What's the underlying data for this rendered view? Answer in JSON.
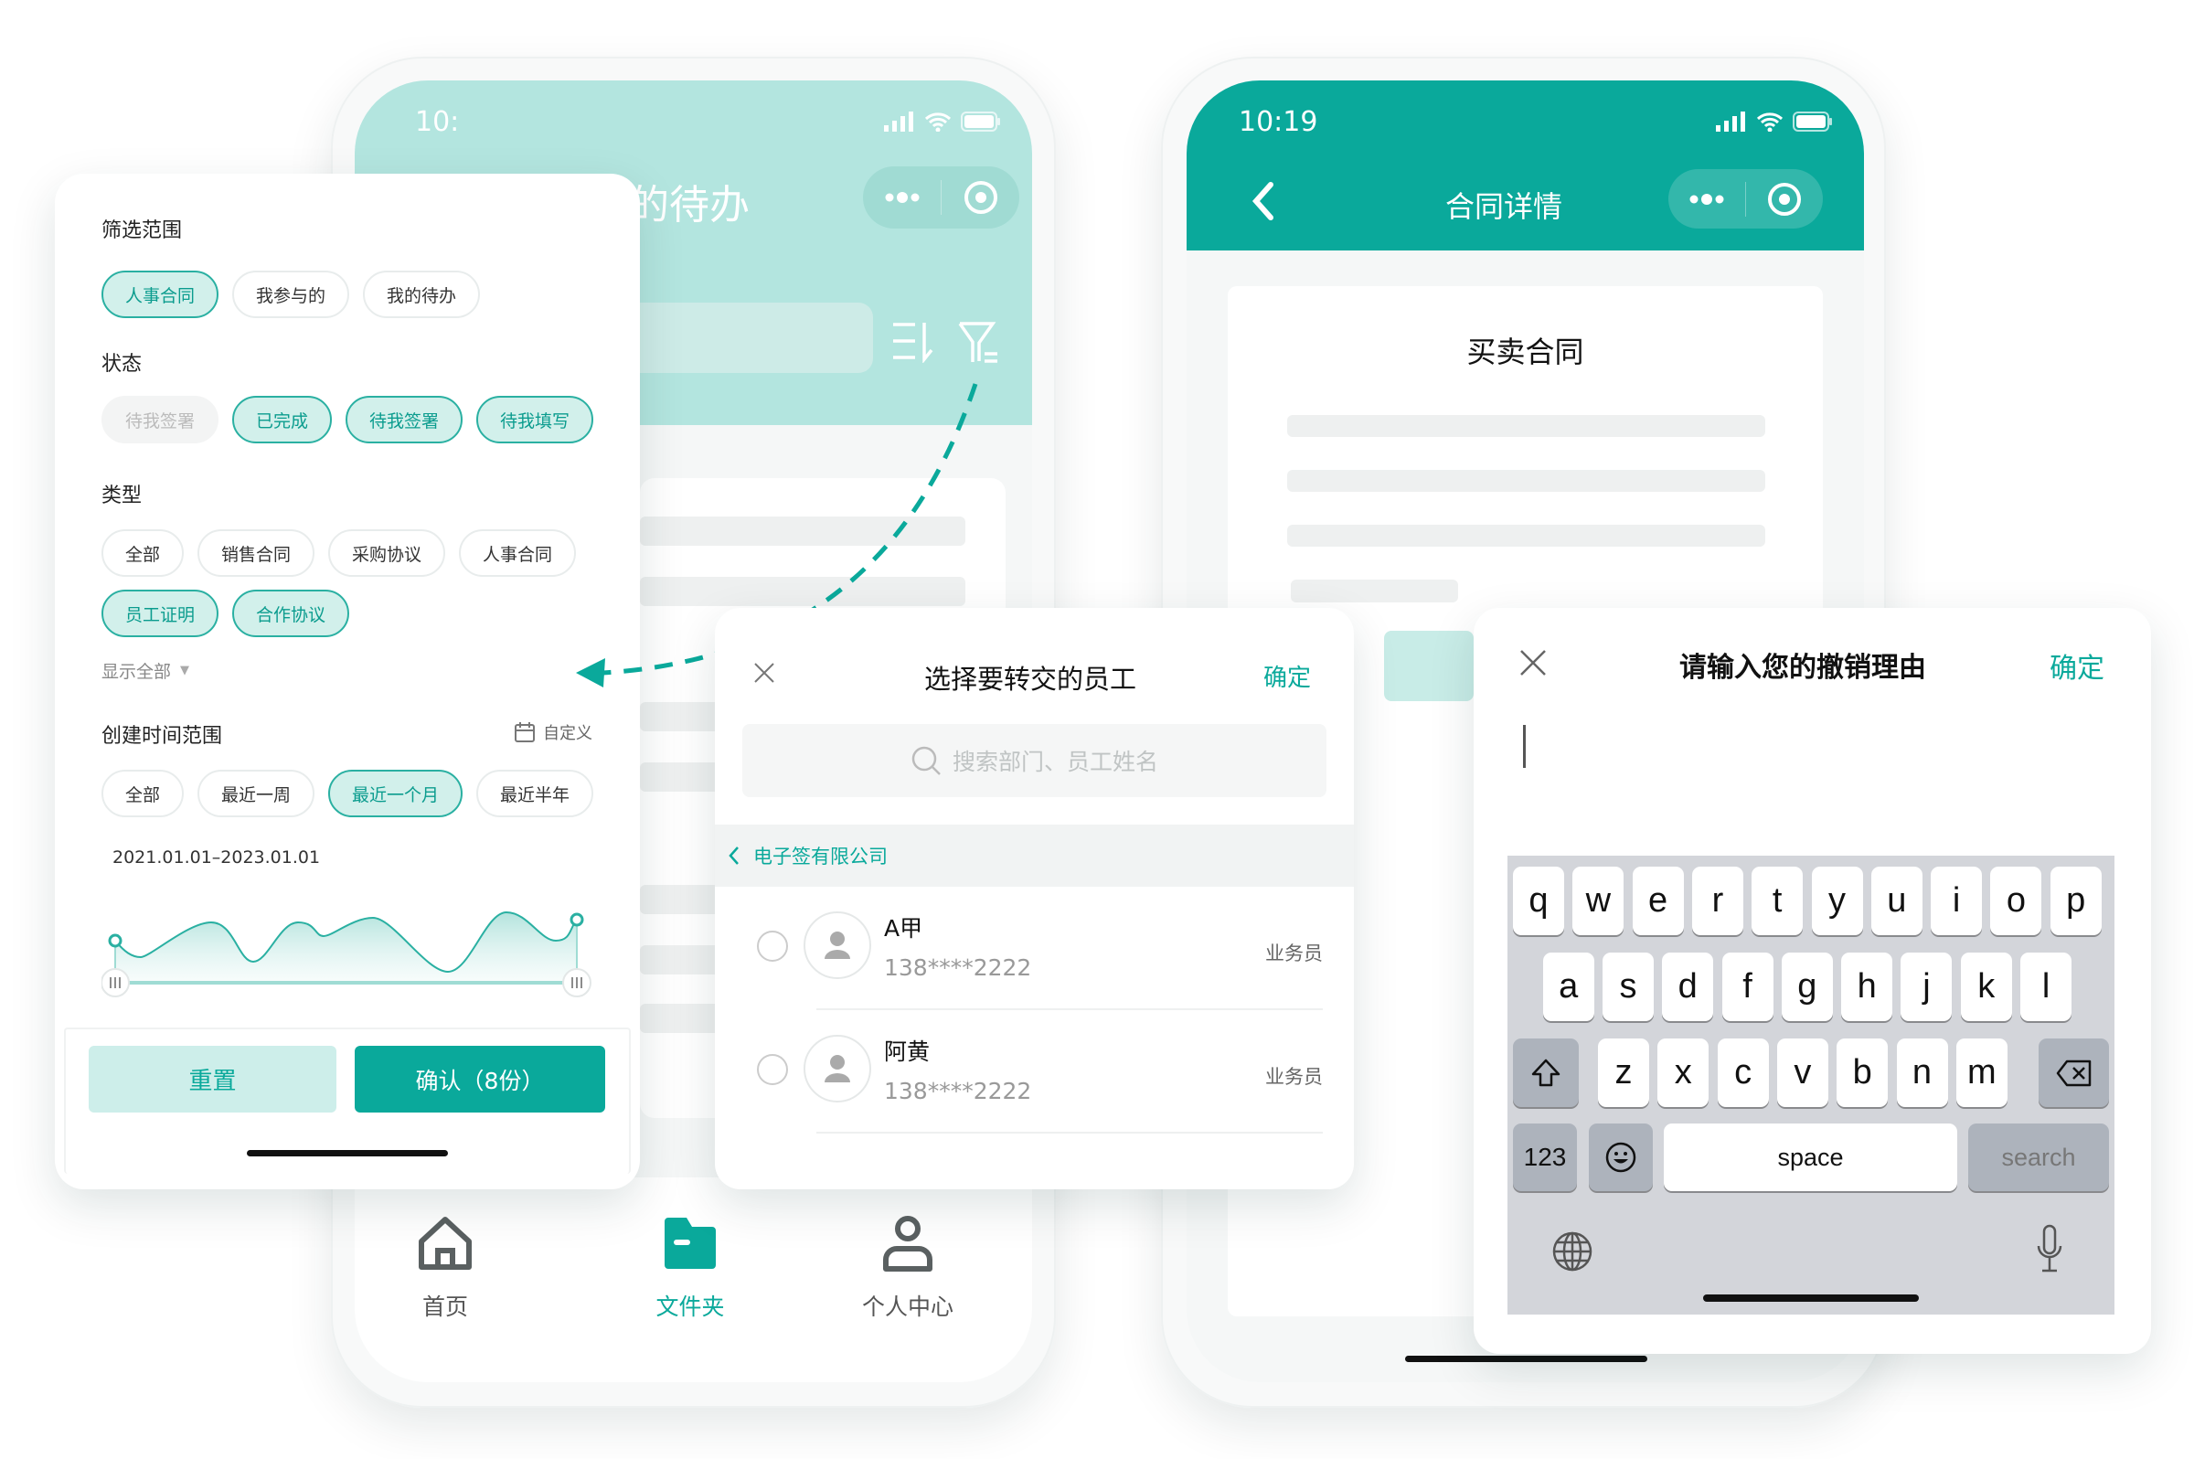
{
  "colors": {
    "brand": "#0aa99b",
    "brand_light": "#b3e5df",
    "chip_selected_bg": "#d2f0eb",
    "keyboard_bg": "#d3d5da"
  },
  "phone_todo": {
    "status_time": "10:",
    "title": "我的待办",
    "capsule_icons": [
      "more-dots-icon",
      "target-icon"
    ],
    "toolbar_icons": [
      "sort-icon",
      "filter-icon"
    ],
    "tabbar": [
      {
        "label": "首页",
        "icon": "home-icon",
        "active": false
      },
      {
        "label": "文件夹",
        "icon": "folder-icon",
        "active": true
      },
      {
        "label": "个人中心",
        "icon": "user-icon",
        "active": false
      }
    ]
  },
  "filter_panel": {
    "scope": {
      "label": "筛选范围",
      "chips": [
        {
          "label": "人事合同",
          "state": "selected"
        },
        {
          "label": "我参与的",
          "state": "normal"
        },
        {
          "label": "我的待办",
          "state": "normal"
        }
      ]
    },
    "status": {
      "label": "状态",
      "chips": [
        {
          "label": "待我签署",
          "state": "disabled"
        },
        {
          "label": "已完成",
          "state": "selected"
        },
        {
          "label": "待我签署",
          "state": "selected"
        },
        {
          "label": "待我填写",
          "state": "selected"
        }
      ]
    },
    "type": {
      "label": "类型",
      "chips": [
        {
          "label": "全部",
          "state": "normal"
        },
        {
          "label": "销售合同",
          "state": "normal"
        },
        {
          "label": "采购协议",
          "state": "normal"
        },
        {
          "label": "人事合同",
          "state": "normal"
        },
        {
          "label": "员工证明",
          "state": "selected"
        },
        {
          "label": "合作协议",
          "state": "selected"
        }
      ],
      "show_all": "显示全部"
    },
    "created": {
      "label": "创建时间范围",
      "custom": "自定义",
      "chips": [
        {
          "label": "全部",
          "state": "normal"
        },
        {
          "label": "最近一周",
          "state": "normal"
        },
        {
          "label": "最近一个月",
          "state": "selected"
        },
        {
          "label": "最近半年",
          "state": "normal"
        }
      ],
      "date_range": "2021.01.01–2023.01.01"
    },
    "reset": "重置",
    "confirm": "确认（8份）"
  },
  "phone_detail": {
    "status_time": "10:19",
    "title": "合同详情",
    "doc_title": "买卖合同"
  },
  "employee_modal": {
    "title": "选择要转交的员工",
    "confirm": "确定",
    "search_placeholder": "搜索部门、员工姓名",
    "breadcrumb": "电子签有限公司",
    "employees": [
      {
        "name": "A甲",
        "phone": "138****2222",
        "role": "业务员",
        "checked": false
      },
      {
        "name": "阿黄",
        "phone": "138****2222",
        "role": "业务员",
        "checked": false
      }
    ]
  },
  "cancel_modal": {
    "title": "请输入您的撤销理由",
    "confirm": "确定",
    "input_value": ""
  },
  "keyboard": {
    "row1": [
      "q",
      "w",
      "e",
      "r",
      "t",
      "y",
      "u",
      "i",
      "o",
      "p"
    ],
    "row2": [
      "a",
      "s",
      "d",
      "f",
      "g",
      "h",
      "j",
      "k",
      "l"
    ],
    "row3": [
      "z",
      "x",
      "c",
      "v",
      "b",
      "n",
      "m"
    ],
    "numbers": "123",
    "space": "space",
    "search": "search"
  }
}
